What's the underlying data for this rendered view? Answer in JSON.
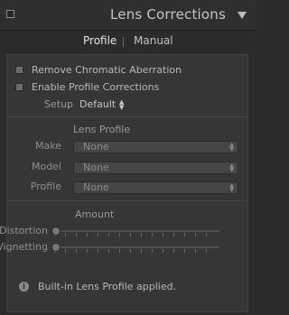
{
  "panel_header": {
    "title": "Lens Corrections"
  },
  "tabs": [
    {
      "label": "Profile",
      "active": true
    },
    {
      "label": "Manual",
      "active": false
    }
  ],
  "options": {
    "remove_ca": {
      "label": "Remove Chromatic Aberration",
      "checked": false
    },
    "enable_profile": {
      "label": "Enable Profile Corrections",
      "checked": false
    }
  },
  "setup": {
    "label": "Setup",
    "value": "Default"
  },
  "lens_profile": {
    "title": "Lens Profile",
    "fields": [
      {
        "label": "Make",
        "value": "None"
      },
      {
        "label": "Model",
        "value": "None"
      },
      {
        "label": "Profile",
        "value": "None"
      }
    ]
  },
  "amount": {
    "title": "Amount",
    "sliders": [
      {
        "label": "Distortion",
        "value": 0
      },
      {
        "label": "Vignetting",
        "value": 0
      }
    ]
  },
  "status": {
    "message": "Built-in Lens Profile applied."
  },
  "colors": {
    "background": "#2b2b2b",
    "panel": "#363636",
    "text": "#a9a9a9"
  }
}
